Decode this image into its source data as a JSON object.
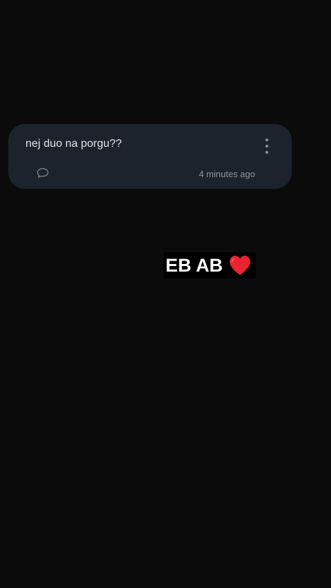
{
  "message": {
    "text": "nej duo na porgu??",
    "time": "4 minutes ago",
    "more_icon": "more-vertical-icon",
    "reply_icon": "chat-bubble-icon"
  },
  "caption": {
    "text": "EB AB",
    "emoji": "heart-icon",
    "emoji_color": "#e8242f"
  }
}
